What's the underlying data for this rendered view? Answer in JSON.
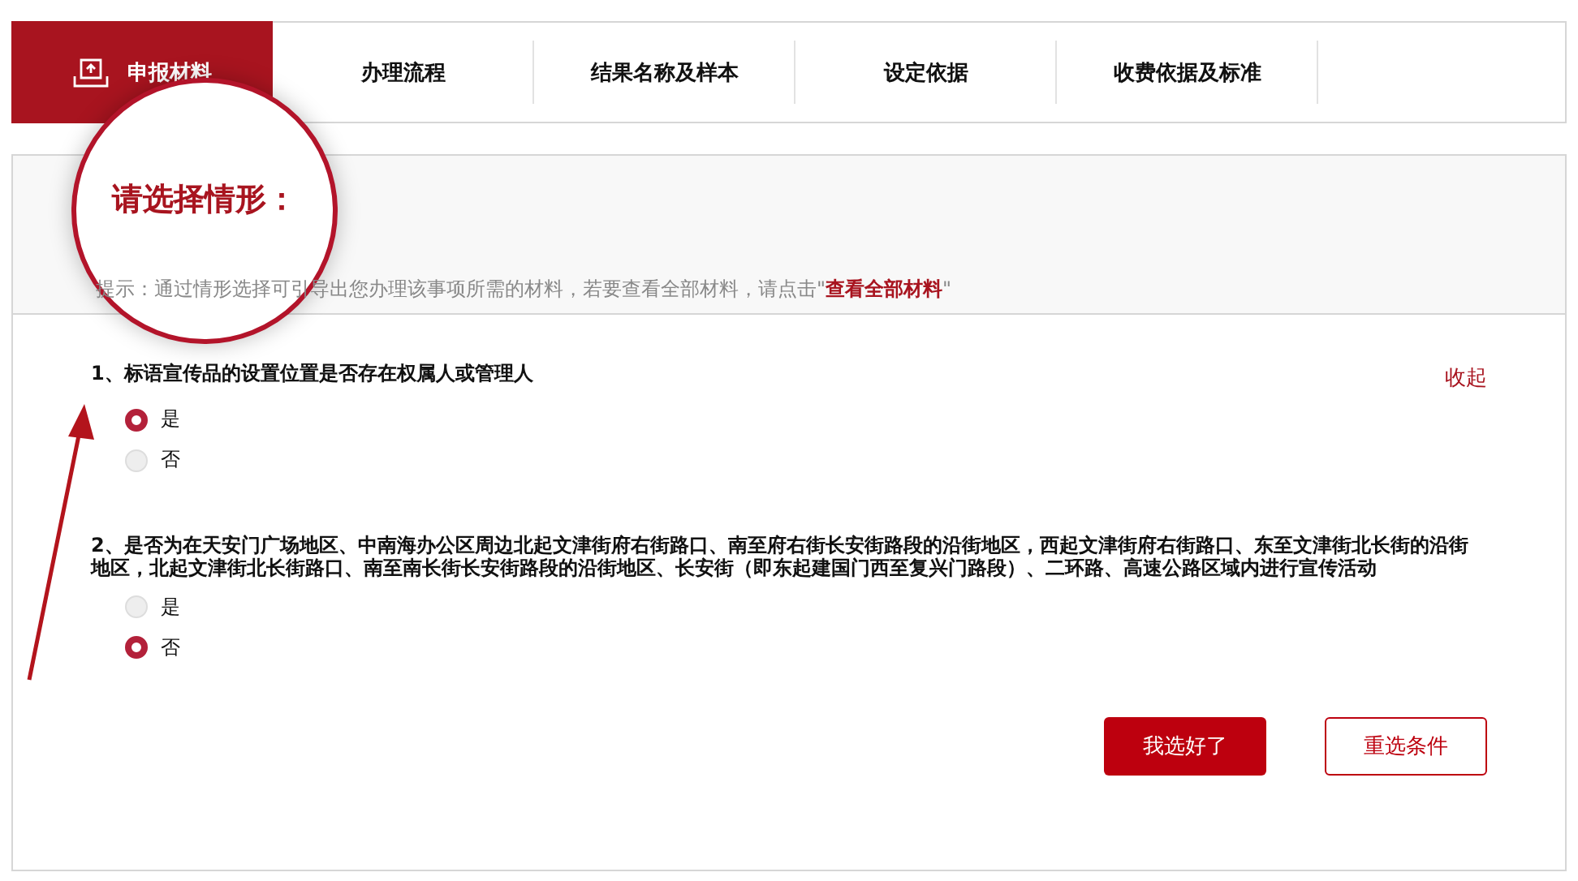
{
  "tabs": [
    {
      "label": "申报材料",
      "selected": true
    },
    {
      "label": "办理流程",
      "selected": false
    },
    {
      "label": "结果名称及样本",
      "selected": false
    },
    {
      "label": "设定依据",
      "selected": false
    },
    {
      "label": "收费依据及标准",
      "selected": false
    }
  ],
  "section": {
    "title": "请选择情形：",
    "hint": "提示：通过情形选择可引导出您办理该事项所需的材料，若要查看全部材料，请点击\"",
    "hint_link": "查看全部材料",
    "hint_end": "\""
  },
  "collapse_link": "收起",
  "questions": [
    {
      "text": "1、标语宣传品的设置位置是否存在权属人或管理人",
      "options": [
        {
          "label": "是",
          "selected": true
        },
        {
          "label": "否",
          "selected": false
        }
      ]
    },
    {
      "text": "2、是否为在天安门广场地区、中南海办公区周边北起文津街府右街路口、南至府右街长安街路段的沿街地区，西起文津街府右街路口、东至文津街北长街的沿街地区，北起文津街北长街路口、南至南长街长安街路段的沿街地区、长安街（即东起建国门西至复兴门路段）、二环路、高速公路区域内进行宣传活动",
      "options": [
        {
          "label": "是",
          "selected": false
        },
        {
          "label": "否",
          "selected": true
        }
      ]
    }
  ],
  "buttons": [
    {
      "label": "我选好了",
      "kind": "primary"
    },
    {
      "label": "重选条件",
      "kind": "outline"
    }
  ]
}
